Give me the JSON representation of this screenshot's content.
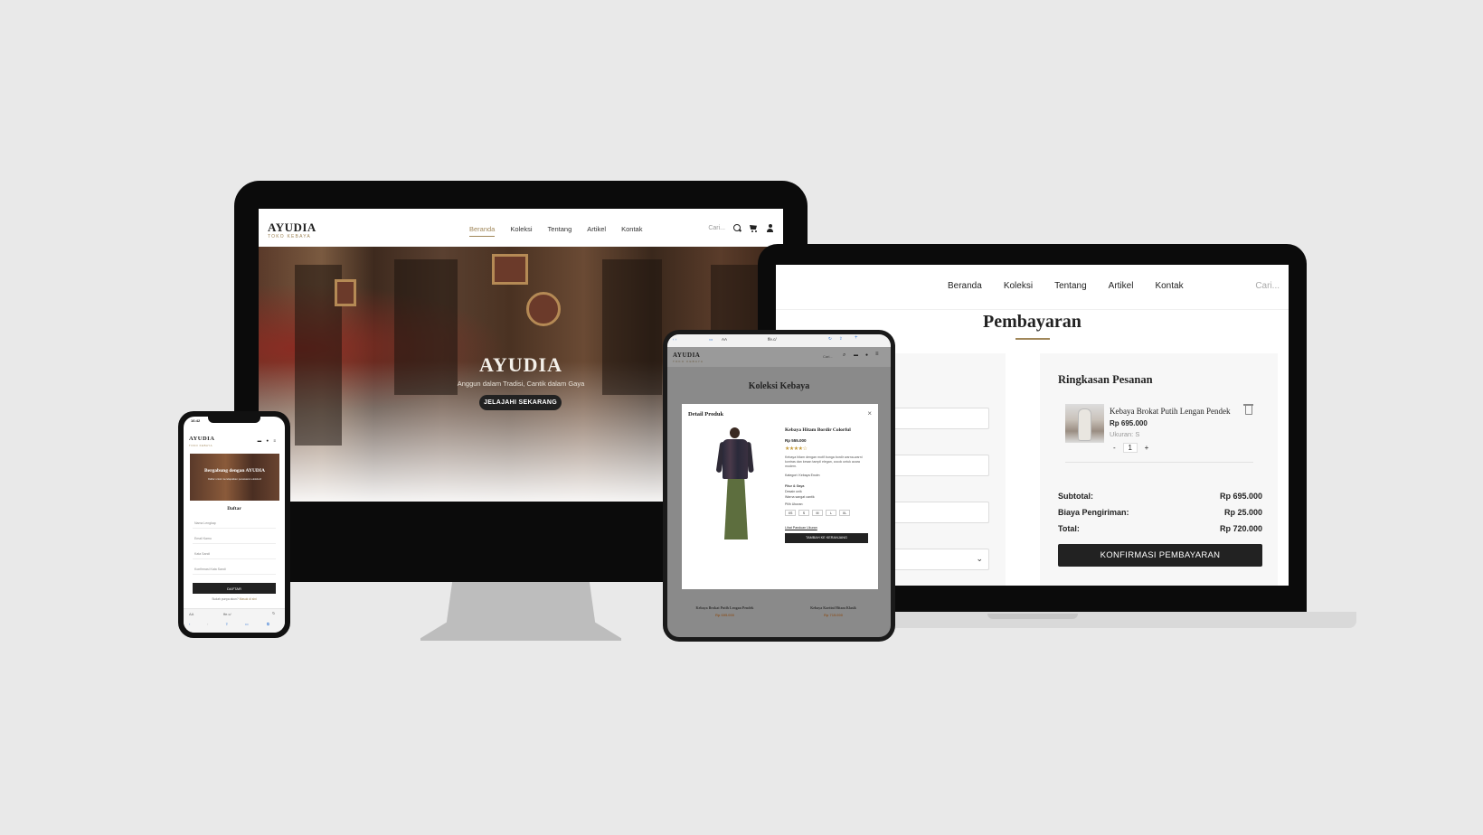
{
  "monitor": {
    "logo": "AYUDIA",
    "logo_sub": "TOKO KEBAYA",
    "nav": [
      "Beranda",
      "Koleksi",
      "Tentang",
      "Artikel",
      "Kontak"
    ],
    "search_placeholder": "Cari...",
    "hero_title": "AYUDIA",
    "hero_tagline": "Anggun dalam Tradisi, Cantik dalam Gaya",
    "hero_button": "JELAJAHI SEKARANG"
  },
  "laptop": {
    "nav": [
      "Beranda",
      "Koleksi",
      "Tentang",
      "Artikel",
      "Kontak"
    ],
    "search_placeholder": "Cari...",
    "page_title": "Pembayaran",
    "summary": {
      "title": "Ringkasan Pesanan",
      "product_name": "Kebaya Brokat Putih Lengan Pendek",
      "product_price": "Rp 695.000",
      "product_size": "Ukuran: S",
      "qty_minus": "-",
      "qty": "1",
      "qty_plus": "+",
      "subtotal_label": "Subtotal:",
      "subtotal": "Rp 695.000",
      "shipping_label": "Biaya Pengiriman:",
      "shipping": "Rp 25.000",
      "total_label": "Total:",
      "total": "Rp 720.000",
      "confirm_button": "KONFIRMASI PEMBAYARAN"
    }
  },
  "tablet": {
    "url": "ffe.c/",
    "logo": "AYUDIA",
    "logo_sub": "TOKO KEBAYA",
    "search_placeholder": "Cari...",
    "page_title": "Koleksi Kebaya",
    "modal": {
      "header": "Detail Produk",
      "close": "×",
      "name": "Kebaya Hitam Bordir Colorful",
      "price": "Rp 555.000",
      "stars": "★★★★☆",
      "description": "Kebaya hitam dengan motif bunga bordir warna-warni kontras dan kesan tampil elegan, cocok untuk acara modern.",
      "category": "Kategori: Kebaya Encim",
      "features_title": "Fitur & Gaya",
      "features": [
        "Desain unik",
        "Warna sangat cantik"
      ],
      "size_label": "Pilih Ukuran:",
      "sizes": [
        "XS",
        "S",
        "M",
        "L",
        "XL"
      ],
      "size_link": "Lihat Panduan Ukuran",
      "add_button": "TAMBAH KE KERANJANG"
    },
    "cards": [
      {
        "name": "Kebaya Brokat Putih Lengan Pendek",
        "price": "Rp 695.000"
      },
      {
        "name": "Kebaya Kartini Hitam Klasik",
        "price": "Rp 715.000"
      }
    ]
  },
  "phone": {
    "time": "16:42",
    "logo": "AYUDIA",
    "logo_sub": "TOKO KEBAYA",
    "hero_title": "Bergabung dengan AYUDIA",
    "hero_sub": "Daftar untuk mendapatkan penawaran eksklusif",
    "form_title": "Daftar",
    "fields": [
      "Nama Lengkap",
      "Email Kamu",
      "Kata Sandi",
      "Konfirmasi Kata Sandi"
    ],
    "button": "DAFTAR",
    "footer_text": "Sudah punya akun?",
    "footer_link": "Masuk di sini",
    "address": "AA",
    "url": "ffe.c/"
  }
}
